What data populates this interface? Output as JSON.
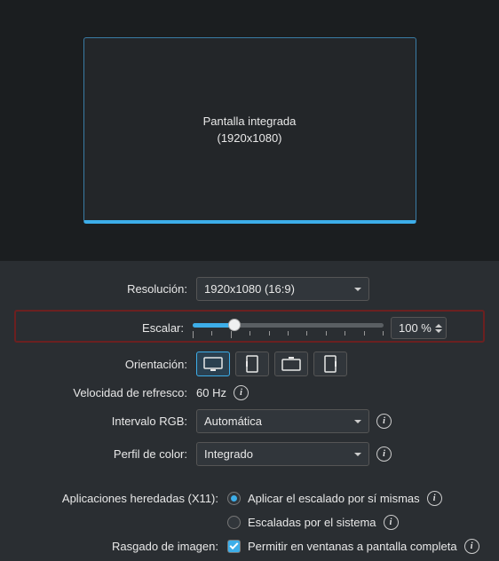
{
  "preview": {
    "name": "Pantalla integrada",
    "resolution": "(1920x1080)"
  },
  "fields": {
    "resolution_label": "Resolución:",
    "resolution_value": "1920x1080 (16:9)",
    "scale_label": "Escalar:",
    "scale_value": "100 %",
    "orientation_label": "Orientación:",
    "refresh_label": "Velocidad de refresco:",
    "refresh_value": "60 Hz",
    "rgb_label": "Intervalo RGB:",
    "rgb_value": "Automática",
    "colorprofile_label": "Perfil de color:",
    "colorprofile_value": "Integrado"
  },
  "legacy": {
    "label": "Aplicaciones heredadas (X11):",
    "opt1": "Aplicar el escalado por sí mismas",
    "opt2": "Escaladas por el sistema"
  },
  "tearing": {
    "label": "Rasgado de imagen:",
    "option": "Permitir en ventanas a pantalla completa"
  }
}
